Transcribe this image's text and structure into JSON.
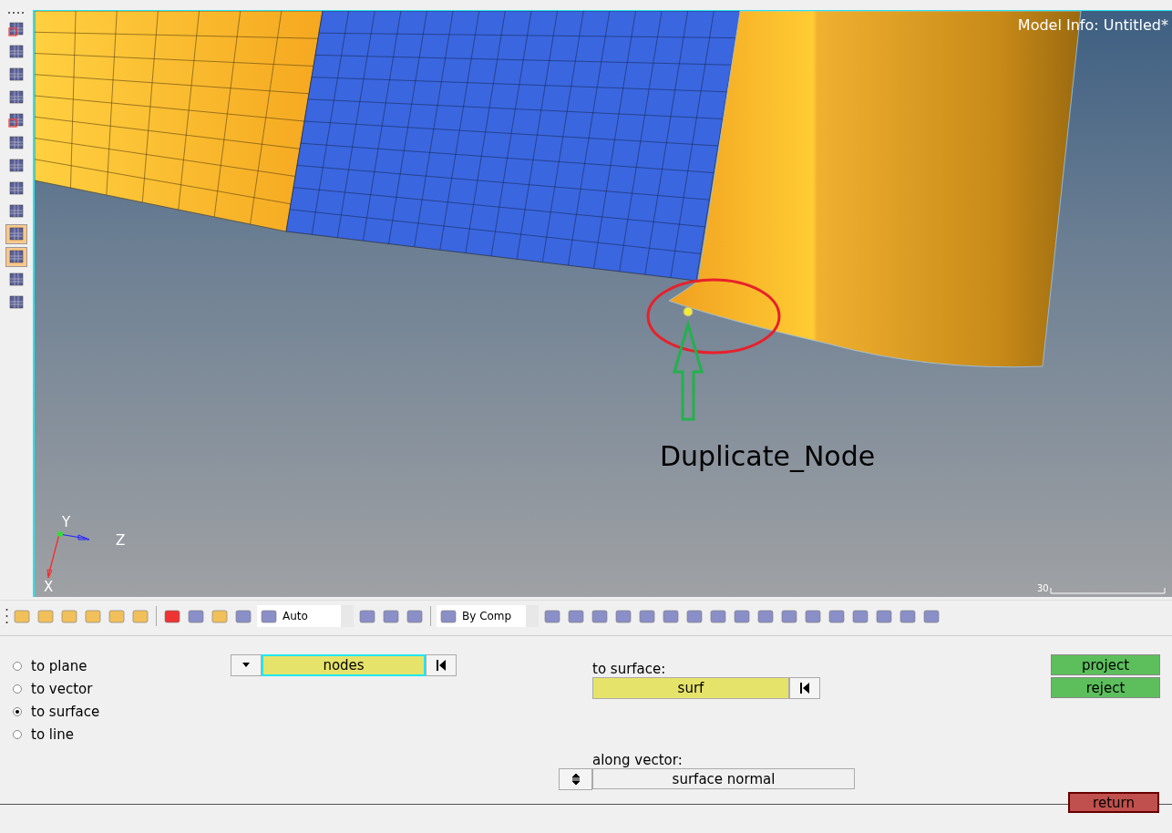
{
  "viewport": {
    "model_info": "Model Info: Untitled*",
    "annotation": "Duplicate_Node",
    "axes": {
      "y": "Y",
      "z": "Z",
      "x": "X"
    },
    "scale": "30"
  },
  "toolbar": {
    "entity_mode": "Auto",
    "color_mode": "By Comp"
  },
  "panel": {
    "options": [
      {
        "label": "to plane",
        "selected": false
      },
      {
        "label": "to vector",
        "selected": false
      },
      {
        "label": "to surface",
        "selected": true
      },
      {
        "label": "to line",
        "selected": false
      }
    ],
    "selector": {
      "value": "nodes",
      "active": true
    },
    "surface_label": "to surface:",
    "surface_selector": {
      "value": "surf",
      "active": false
    },
    "vector_label": "along vector:",
    "vector_button": "surface normal",
    "actions": [
      "project",
      "reject"
    ],
    "return_button": "return"
  }
}
